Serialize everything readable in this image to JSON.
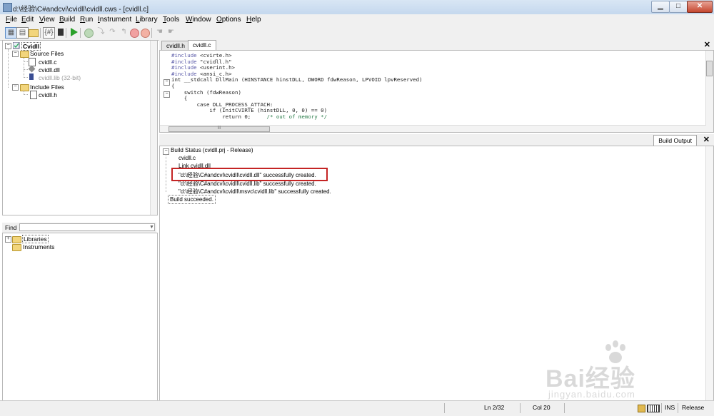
{
  "window": {
    "title": "d:\\经验\\C#andcvi\\cvidll\\cvidll.cws - [cvidll.c]",
    "min_glyph": "▁",
    "max_glyph": "□",
    "close_glyph": "✕"
  },
  "menu": [
    "File",
    "Edit",
    "View",
    "Build",
    "Run",
    "Instrument",
    "Library",
    "Tools",
    "Window",
    "Options",
    "Help"
  ],
  "toolbar": {
    "icons": [
      "workspace-icon",
      "project-icon",
      "open-icon",
      "include-icon",
      "chip-icon",
      "run-icon",
      "breakpoint-icon",
      "step-icon",
      "step-over-icon",
      "step-out-icon",
      "stop-icon",
      "terminate-icon",
      "hand-icon",
      "hand2-icon"
    ]
  },
  "project_tree": {
    "root": "Cvidll",
    "source_folder": "Source Files",
    "source_files": [
      "cvidll.c",
      "cvidll.dll"
    ],
    "lib_file": "cvidll.lib (32-bit)",
    "include_folder": "Include Files",
    "include_files": [
      "cvidll.h"
    ]
  },
  "find": {
    "label": "Find",
    "value": "",
    "drop_glyph": "▼"
  },
  "library_tree": {
    "items": [
      "Libraries",
      "Instruments"
    ]
  },
  "editor": {
    "tabs": [
      "cvidll.h",
      "cvidll.c"
    ],
    "active_tab": 1,
    "close_glyph": "✕",
    "scroll_label": "III"
  },
  "output": {
    "tab": "Build Output",
    "close_glyph": "✕",
    "status_header": "Build Status (cvidll.prj - Release)",
    "lines": [
      "cvidll.c",
      "Link cvidll.dll",
      "\"d:\\经验\\C#andcvi\\cvidll\\cvidll.dll\" successfully created.",
      "\"d:\\经验\\C#andcvi\\cvidll\\cvidll.lib\" successfully created.",
      "\"d:\\经验\\C#andcvi\\cvidll\\msvc\\cvidll.lib\" successfully created."
    ],
    "result": "Build succeeded."
  },
  "status": {
    "line": "Ln 2/32",
    "col": "Col 20",
    "mode": "INS",
    "config": "Release"
  },
  "watermark": {
    "brand": "Bai经验",
    "url": "jingyan.baidu.com"
  },
  "colors": {
    "accent_highlight": "#c42424",
    "titlebar": "#c5d8ee",
    "run_green": "#2aa12a"
  }
}
